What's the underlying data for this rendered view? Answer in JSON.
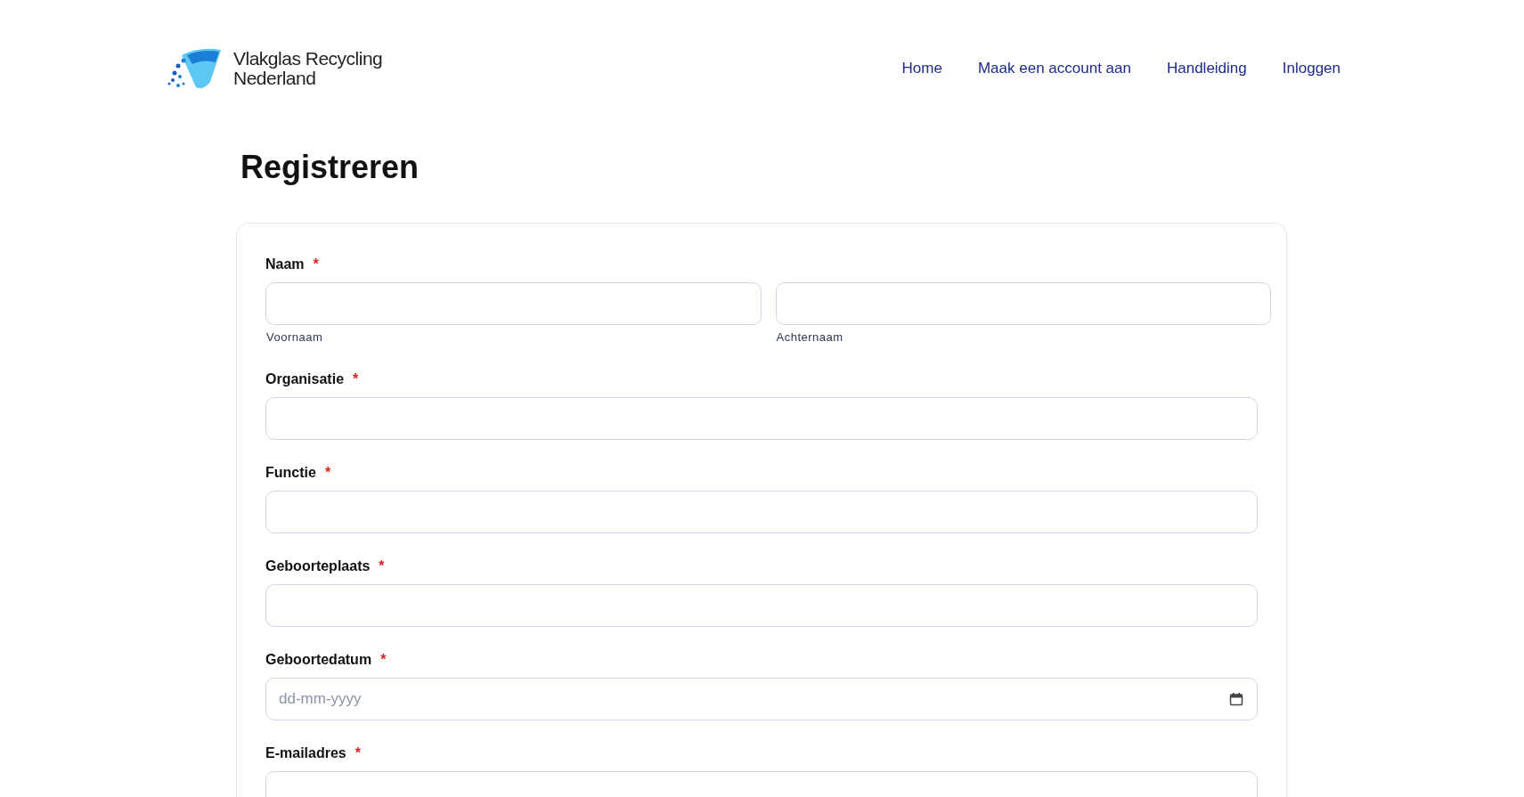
{
  "logo": {
    "line_1": "Vlakglas Recycling",
    "line_2": "Nederland"
  },
  "nav": [
    {
      "label": "Home"
    },
    {
      "label": "Maak een account aan"
    },
    {
      "label": "Handleiding"
    },
    {
      "label": "Inloggen"
    }
  ],
  "title": "Registreren",
  "fields": [
    {
      "kind": "pair",
      "label": "Naam",
      "required_mark": "*",
      "parts": [
        {
          "caption": "Voornaam"
        },
        {
          "caption": "Achternaam"
        }
      ]
    },
    {
      "kind": "text",
      "label": "Organisatie",
      "required_mark": "*"
    },
    {
      "kind": "text",
      "label": "Functie",
      "required_mark": "*"
    },
    {
      "kind": "text",
      "label": "Geboorteplaats",
      "required_mark": "*"
    },
    {
      "kind": "date",
      "label": "Geboortedatum",
      "required_mark": "*",
      "placeholder": "dd-mm-yyyy"
    },
    {
      "kind": "text",
      "label": "E-mailadres",
      "required_mark": "*"
    }
  ]
}
